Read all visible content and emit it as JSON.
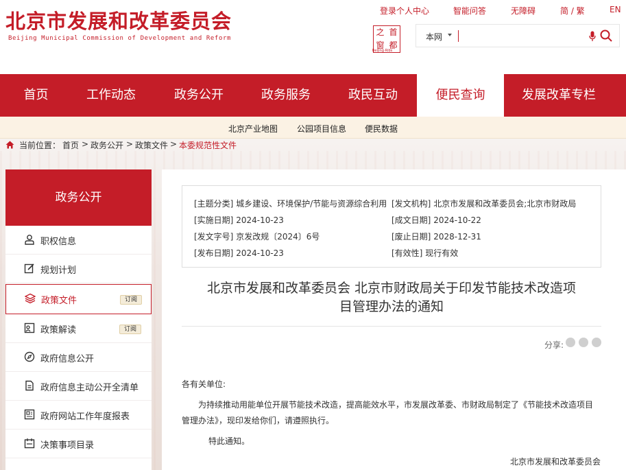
{
  "header": {
    "logo_cn": "北京市发展和改革委员会",
    "logo_en": "Beijing Municipal Commission of Development and Reform",
    "top_links": [
      "登录个人中心",
      "智能问答",
      "无障碍",
      "简 / 繁",
      "EN"
    ],
    "seal_chars": [
      "首",
      "都",
      "之",
      "窗"
    ],
    "seal_sub": "Beijing·Ribs",
    "search": {
      "scope": "本网",
      "placeholder": ""
    }
  },
  "nav": {
    "items": [
      "首页",
      "工作动态",
      "政务公开",
      "政务服务",
      "政民互动",
      "便民查询",
      "发展改革专栏"
    ],
    "active_index": 5
  },
  "subnav": {
    "items": [
      "北京产业地图",
      "公园项目信息",
      "便民数据"
    ]
  },
  "breadcrumb": {
    "label": "当前位置：",
    "items": [
      "首页",
      ">",
      "政务公开",
      ">",
      "政策文件",
      ">",
      "本委规范性文件"
    ]
  },
  "sidebar": {
    "title": "政务公开",
    "items": [
      {
        "label": "职权信息",
        "icon": "person-icon"
      },
      {
        "label": "规划计划",
        "icon": "edit-icon"
      },
      {
        "label": "政策文件",
        "icon": "layers-icon",
        "badge": "订阅",
        "active": true
      },
      {
        "label": "政策解读",
        "icon": "interpret-icon",
        "badge": "订阅"
      },
      {
        "label": "政府信息公开",
        "icon": "compass-icon"
      },
      {
        "label": "政府信息主动公开全清单",
        "icon": "list-doc-icon"
      },
      {
        "label": "政府网站工作年度报表",
        "icon": "report-icon"
      },
      {
        "label": "决策事项目录",
        "icon": "calendar-icon"
      }
    ]
  },
  "meta": {
    "topic_key": "[主题分类]",
    "topic": "城乡建设、环境保护/节能与资源综合利用",
    "org_key": "[发文机构]",
    "org": "北京市发展和改革委员会;北京市财政局",
    "impl_key": "[实施日期]",
    "impl": "2024-10-23",
    "made_key": "[成文日期]",
    "made": "2024-10-22",
    "no_key": "[发文字号]",
    "no": "京发改规〔2024〕6号",
    "expire_key": "[废止日期]",
    "expire": "2028-12-31",
    "pub_key": "[发布日期]",
    "pub": "2024-10-23",
    "valid_key": "[有效性]",
    "valid": "现行有效"
  },
  "article": {
    "title_line1": "北京市发展和改革委员会 北京市财政局关于印发节能技术改造项",
    "title_line2": "目管理办法的通知",
    "share_label": "分享:",
    "greeting": "各有关单位:",
    "para1_line1": "为持续推动用能单位开展节能技术改造，提高能效水平，市发展改革委、市财政局制定了《节能技术改造项目",
    "para1_line2": "管理办法》，现印发给你们，请遵照执行。",
    "closing": "特此通知。",
    "signature": "北京市发展和改革委员会"
  },
  "colors": {
    "brand": "#c41d28",
    "subnav_bg": "#fbf2e4"
  }
}
